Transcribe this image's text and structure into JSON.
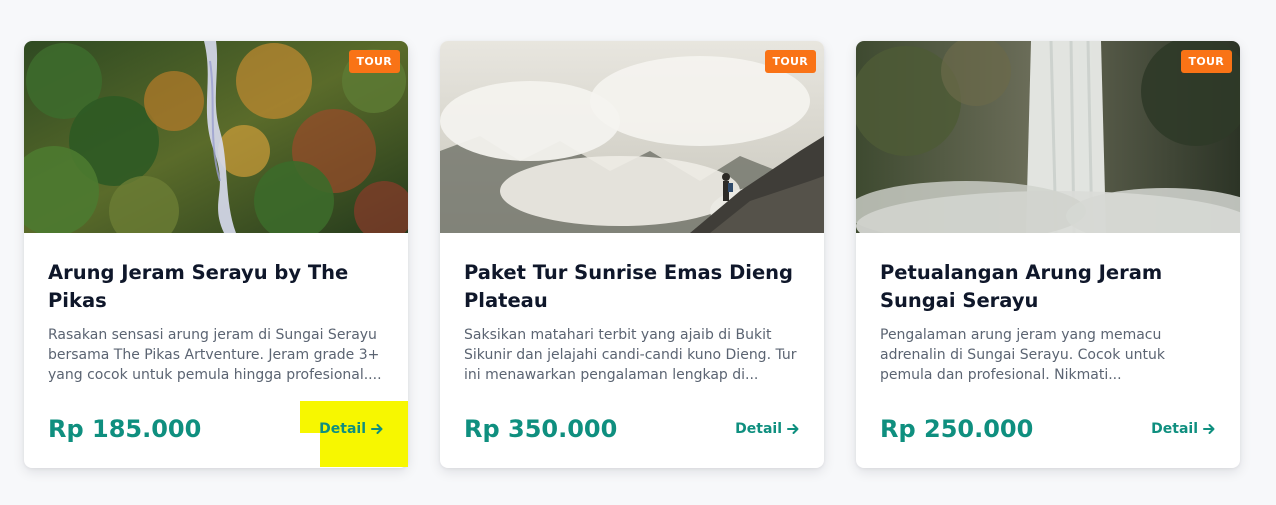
{
  "cards": [
    {
      "badge": "TOUR",
      "title": "Arung Jeram Serayu by The Pikas",
      "description": "Rasakan sensasi arung jeram di Sungai Serayu bersama The Pikas Artventure. Jeram grade 3+ yang cocok untuk pemula hingga profesional....",
      "price": "Rp 185.000",
      "detail_label": "Detail",
      "image_icon": "waterfall-forest-image"
    },
    {
      "badge": "TOUR",
      "title": "Paket Tur Sunrise Emas Dieng Plateau",
      "description": "Saksikan matahari terbit yang ajaib di Bukit Sikunir dan jelajahi candi-candi kuno Dieng. Tur ini menawarkan pengalaman lengkap di...",
      "price": "Rp 350.000",
      "detail_label": "Detail",
      "image_icon": "mountain-clouds-image"
    },
    {
      "badge": "TOUR",
      "title": "Petualangan Arung Jeram Sungai Serayu",
      "description": "Pengalaman arung jeram yang memacu adrenalin di Sungai Serayu. Cocok untuk pemula dan profesional. Nikmati...",
      "price": "Rp 250.000",
      "detail_label": "Detail",
      "image_icon": "waterfall-mist-image"
    }
  ],
  "colors": {
    "accent": "#0f8f7f",
    "badge": "#f97316",
    "highlight": "#f7f700",
    "title": "#0f172a",
    "text": "#5b6472"
  }
}
